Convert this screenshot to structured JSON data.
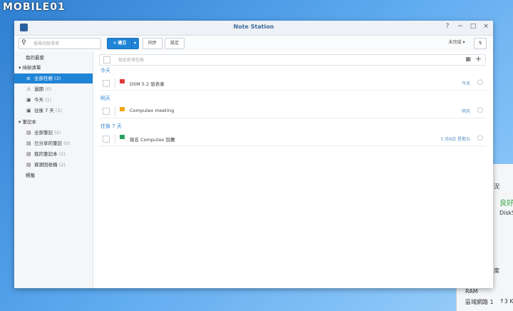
{
  "watermark": "MOBILE01",
  "window": {
    "title": "Note Station",
    "controls": [
      "?",
      "−",
      "□",
      "×"
    ]
  },
  "toolbar": {
    "search_placeholder": "搜尋待辦清單",
    "new_label": "+ 建立",
    "new_dropdown": "▾",
    "sync_label": "同步",
    "settings_label": "設定",
    "filter_label": "未完成 ▾",
    "sort_icon": "sort-icon"
  },
  "sidebar": {
    "recent": "我的最愛",
    "todo_header": "▾ 待辦清單",
    "todo_items": [
      {
        "icon": "list-icon",
        "label": "全部任務",
        "count": "(3)",
        "active": true
      },
      {
        "icon": "warning-icon",
        "label": "過期",
        "count": "(0)"
      },
      {
        "icon": "calendar-icon",
        "label": "今天",
        "count": "(1)"
      },
      {
        "icon": "calendar-week-icon",
        "label": "往後 7 天",
        "count": "(3)"
      }
    ],
    "notebook_header": "▾ 筆記本",
    "notebook_items": [
      {
        "icon": "notes-icon",
        "label": "全部筆記",
        "count": "(2)"
      },
      {
        "icon": "shared-icon",
        "label": "已分享的筆記",
        "count": "(0)"
      },
      {
        "icon": "notebook-icon",
        "label": "我的筆記本",
        "count": "(2)"
      },
      {
        "icon": "trash-icon",
        "label": "資源回收桶",
        "count": "(2)"
      }
    ],
    "tags": "標籤"
  },
  "main": {
    "quick_placeholder": "按此新增任務",
    "sections": [
      {
        "label": "今天",
        "tasks": [
          {
            "text": "DSM 5.2 發表會",
            "due": "今天",
            "flag_color": "#e03b3b"
          }
        ]
      },
      {
        "label": "明天",
        "tasks": [
          {
            "text": "Computex meeting",
            "due": "明天",
            "flag_color": "#f2a516"
          }
        ]
      },
      {
        "label": "往後 7 天",
        "tasks": [
          {
            "text": "報名 Computex 說攤",
            "due": "5 月8日 星期五",
            "flag_color": "#26a160"
          }
        ]
      }
    ]
  },
  "bg_panel": {
    "title": "況",
    "status": "良好",
    "sub": "DiskS",
    "cpu": "度",
    "ram": "RAM",
    "net": "區域網路 1",
    "speed": "↑3 K"
  }
}
